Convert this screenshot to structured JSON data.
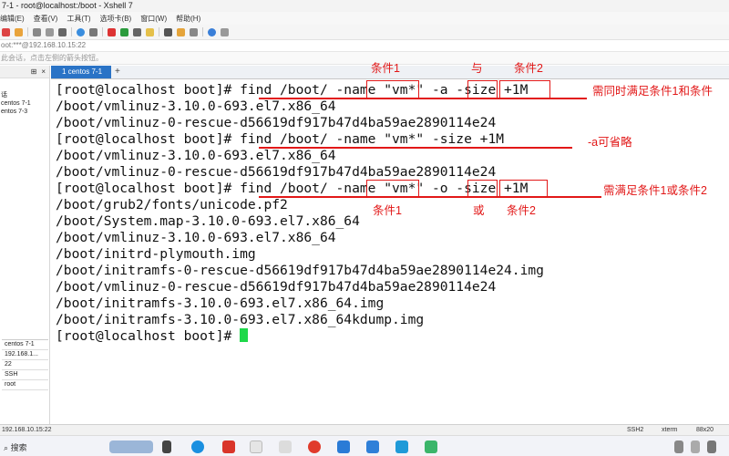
{
  "window": {
    "title": "7-1 - root@localhost:/boot - Xshell 7"
  },
  "menu": [
    "编辑(E)",
    "查看(V)",
    "工具(T)",
    "选项卡(B)",
    "窗口(W)",
    "帮助(H)"
  ],
  "address": "oot:***@192.168.10.15:22",
  "hint": "此会话，点击左侧的箭头按钮。",
  "left_pane": {
    "tree": [
      "话",
      "centos 7-1",
      "entos 7-3"
    ],
    "properties": [
      "centos 7-1",
      "192.168.1...",
      "22",
      "SSH",
      "root"
    ]
  },
  "tab": {
    "label": "1 centos 7-1",
    "add": "+"
  },
  "terminal": {
    "lines": [
      "[root@localhost boot]# find /boot/ -name \"vm*\" -a -size +1M",
      "/boot/vmlinuz-3.10.0-693.el7.x86_64",
      "/boot/vmlinuz-0-rescue-d56619df917b47d4ba59ae2890114e24",
      "[root@localhost boot]# find /boot/ -name \"vm*\" -size +1M",
      "/boot/vmlinuz-3.10.0-693.el7.x86_64",
      "/boot/vmlinuz-0-rescue-d56619df917b47d4ba59ae2890114e24",
      "[root@localhost boot]# find /boot/ -name \"vm*\" -o -size +1M",
      "/boot/grub2/fonts/unicode.pf2",
      "/boot/System.map-3.10.0-693.el7.x86_64",
      "/boot/vmlinuz-3.10.0-693.el7.x86_64",
      "/boot/initrd-plymouth.img",
      "/boot/initramfs-0-rescue-d56619df917b47d4ba59ae2890114e24.img",
      "/boot/vmlinuz-0-rescue-d56619df917b47d4ba59ae2890114e24",
      "/boot/initramfs-3.10.0-693.el7.x86_64.img",
      "/boot/initramfs-3.10.0-693.el7.x86_64kdump.img"
    ],
    "prompt": "[root@localhost boot]# "
  },
  "annotations": {
    "cond1_top": "条件1",
    "and": "与",
    "cond2_top": "条件2",
    "note1": "需同时满足条件1和条件",
    "note2": "-a可省略",
    "note3": "需满足条件1或条件2",
    "cond1_bottom": "条件1",
    "or": "或",
    "cond2_bottom": "条件2"
  },
  "status": {
    "left": "192.168.10.15:22",
    "protocol": "SSH2",
    "term": "xterm",
    "size": "88x20"
  },
  "taskbar": {
    "search": "搜索"
  },
  "colors": {
    "annotation": "#e21818",
    "cursor": "#1ed84a",
    "tab": "#2a73c6"
  }
}
